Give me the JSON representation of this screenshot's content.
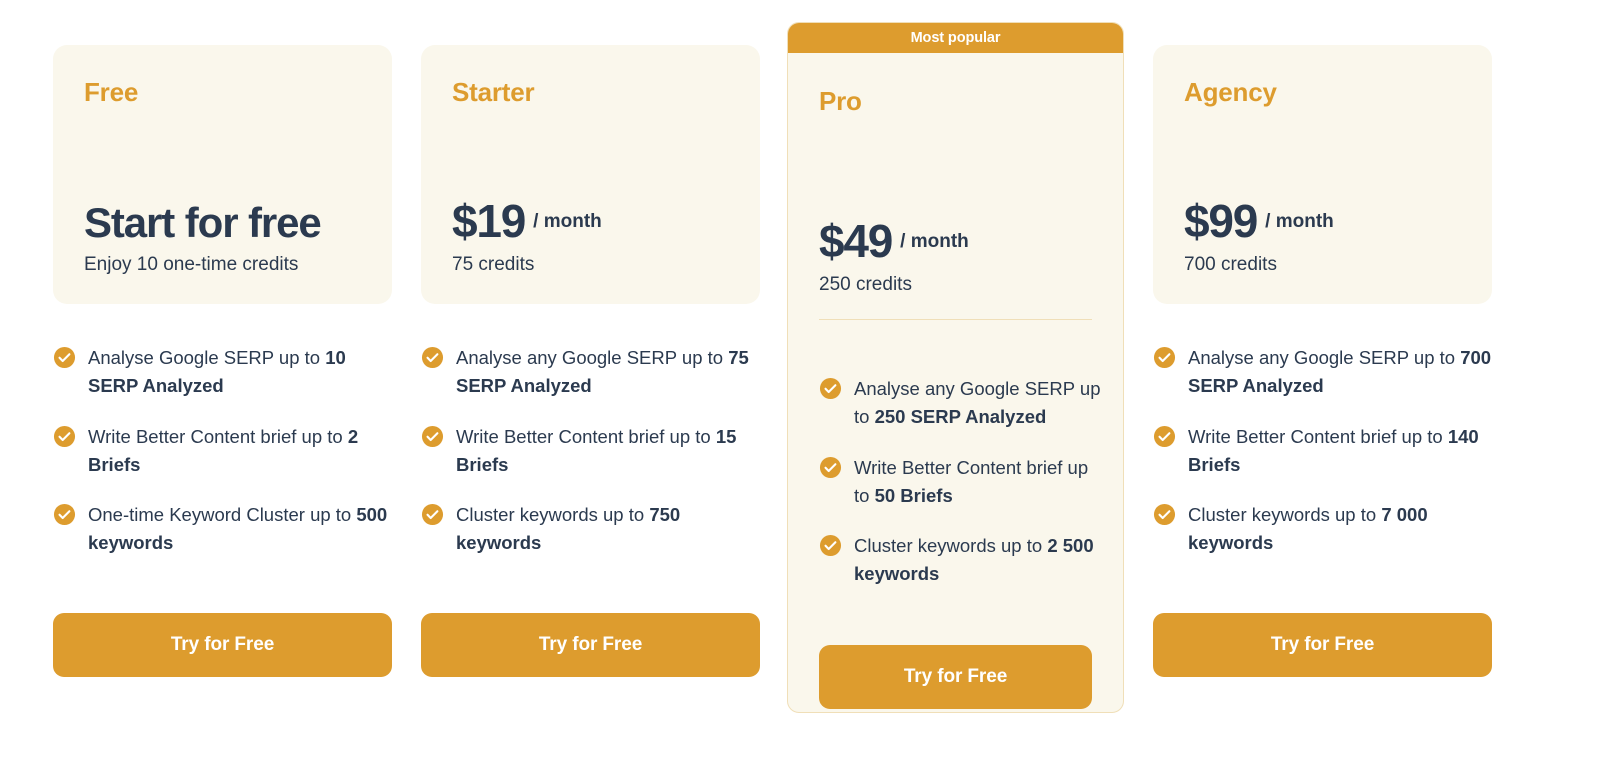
{
  "plans": [
    {
      "name": "Free",
      "price_headline": "Start for free",
      "price_period": "",
      "credits": "Enjoy 10 one-time credits",
      "features": [
        {
          "lead": "Analyse Google SERP up to ",
          "strong": "10 SERP Analyzed",
          "tail": ""
        },
        {
          "lead": "Write Better Content brief up to ",
          "strong": "2 Briefs",
          "tail": ""
        },
        {
          "lead": "One-time Keyword Cluster up to ",
          "strong": "500 keywords",
          "tail": ""
        }
      ],
      "cta_label": "Try for Free"
    },
    {
      "name": "Starter",
      "price_amount": "$19",
      "price_period": "/ month",
      "credits": "75 credits",
      "features": [
        {
          "lead": "Analyse any Google SERP up to ",
          "strong": "75 SERP Analyzed",
          "tail": ""
        },
        {
          "lead": "Write Better Content brief up to ",
          "strong": "15 Briefs",
          "tail": ""
        },
        {
          "lead": "Cluster keywords up to ",
          "strong": "750 keywords",
          "tail": ""
        }
      ],
      "cta_label": "Try for Free"
    },
    {
      "name": "Pro",
      "badge": "Most popular",
      "price_amount": "$49",
      "price_period": "/ month",
      "credits": "250 credits",
      "features": [
        {
          "lead": "Analyse any Google SERP up to ",
          "strong": "250 SERP Analyzed",
          "tail": ""
        },
        {
          "lead": "Write Better Content brief up to ",
          "strong": "50 Briefs",
          "tail": ""
        },
        {
          "lead": "Cluster keywords up to ",
          "strong": "2 500 keywords",
          "tail": ""
        }
      ],
      "cta_label": "Try for Free"
    },
    {
      "name": "Agency",
      "price_amount": "$99",
      "price_period": "/ month",
      "credits": "700 credits",
      "features": [
        {
          "lead": "Analyse any Google SERP up to ",
          "strong": "700 SERP Analyzed",
          "tail": ""
        },
        {
          "lead": "Write Better Content brief up to ",
          "strong": "140 Briefs",
          "tail": ""
        },
        {
          "lead": "Cluster keywords up to ",
          "strong": "7 000 keywords",
          "tail": ""
        }
      ],
      "cta_label": "Try for Free"
    }
  ],
  "icons": {
    "check": "check-circle-icon"
  },
  "colors": {
    "accent": "#dd9c2e",
    "card_background": "#faf7ec",
    "text": "#2b3a4f",
    "page_background": "#ffffff",
    "divider": "#f0dfb8"
  }
}
